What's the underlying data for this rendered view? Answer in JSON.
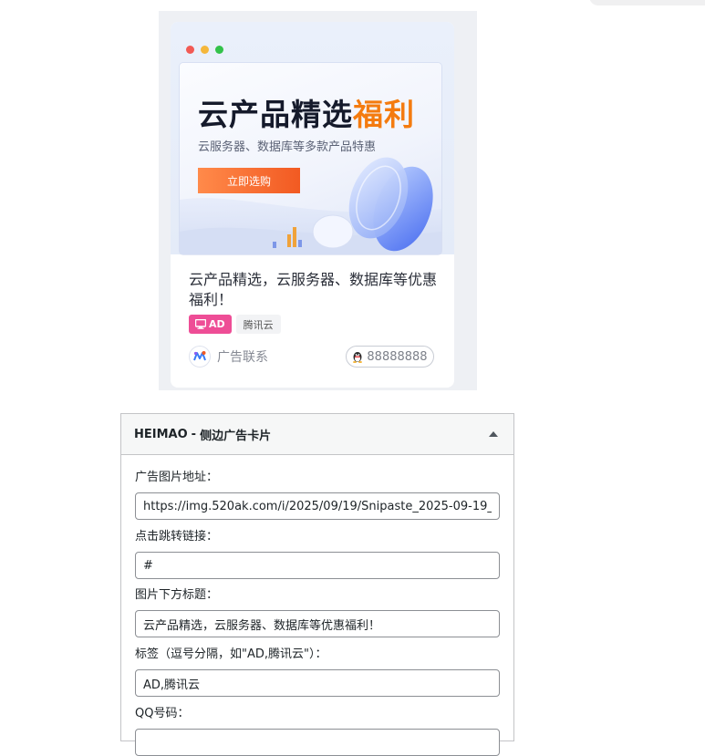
{
  "preview": {
    "banner": {
      "title_main": "云产品精选",
      "title_highlight": "福利",
      "subtitle": "云服务器、数据库等多款产品特惠",
      "button_label": "立即选购"
    },
    "card_title": "云产品精选，云服务器、数据库等优惠福利！",
    "tags": [
      "AD",
      "腾讯云"
    ],
    "contact_label": "广告联系",
    "qq_number": "88888888"
  },
  "widget": {
    "name": "HEIMAO",
    "separator": "-",
    "title": "侧边广告卡片",
    "fields": [
      {
        "label": "广告图片地址：",
        "value": "https://img.520ak.com/i/2025/09/19/Snipaste_2025-09-19_16-"
      },
      {
        "label": "点击跳转链接：",
        "value": "#"
      },
      {
        "label": "图片下方标题：",
        "value": "云产品精选，云服务器、数据库等优惠福利！"
      },
      {
        "label": "标签（逗号分隔，如\"AD,腾讯云\"）：",
        "value": "AD,腾讯云"
      },
      {
        "label": "QQ号码：",
        "value": ""
      }
    ]
  },
  "colors": {
    "accent_orange": "#f47b0f",
    "ad_tag_pink": "#ee4d96",
    "dot_red": "#f25a54",
    "dot_yellow": "#f5b73b",
    "dot_green": "#33c24a"
  },
  "icons": {
    "toggle": "triangle-up-icon",
    "ad_tag": "monitor-icon",
    "qq": "penguin-icon",
    "contact": "brand-logo-icon"
  }
}
